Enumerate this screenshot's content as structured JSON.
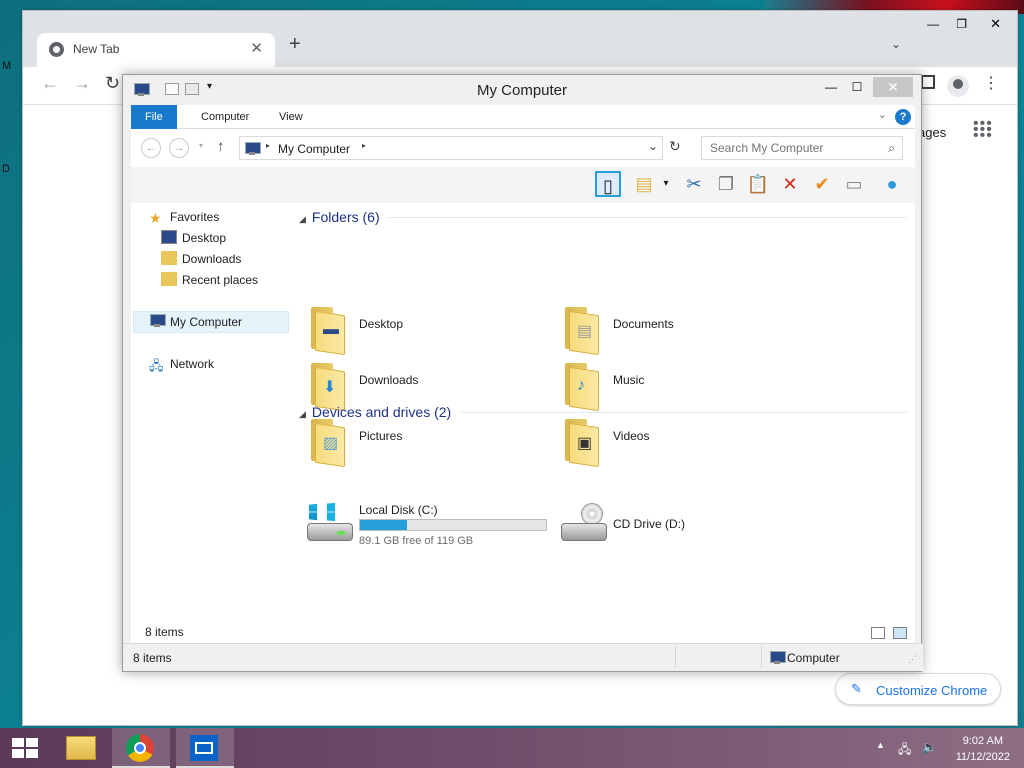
{
  "desktop": {
    "left_letters": [
      "M",
      "D"
    ]
  },
  "chrome": {
    "tab_title": "New Tab",
    "tab_close": "✕",
    "new_tab": "+",
    "tab_menu": "⌄",
    "win_min": "—",
    "win_max": "❐",
    "win_close": "✕",
    "partial_text": "ages",
    "customize_label": "Customize Chrome"
  },
  "explorer": {
    "title": "My Computer",
    "ribbon_tabs": [
      "File",
      "Computer",
      "View"
    ],
    "help": "?",
    "address": "My Computer",
    "search_placeholder": "Search My Computer",
    "nav": {
      "favorites": "Favorites",
      "desktop": "Desktop",
      "downloads": "Downloads",
      "recent": "Recent places",
      "my_computer": "My Computer",
      "network": "Network"
    },
    "folders_header": "Folders (6)",
    "folders": [
      "Desktop",
      "Documents",
      "Downloads",
      "Music",
      "Pictures",
      "Videos"
    ],
    "devices_header": "Devices and drives (2)",
    "drives": [
      {
        "name": "Local Disk (C:)",
        "free": "89.1 GB free of 119 GB",
        "used_fraction": 0.25
      },
      {
        "name": "CD Drive (D:)"
      }
    ],
    "item_count": "8 items",
    "status_left": "8 items",
    "status_right": "Computer"
  },
  "taskbar": {
    "time": "9:02 AM",
    "date": "11/12/2022"
  }
}
